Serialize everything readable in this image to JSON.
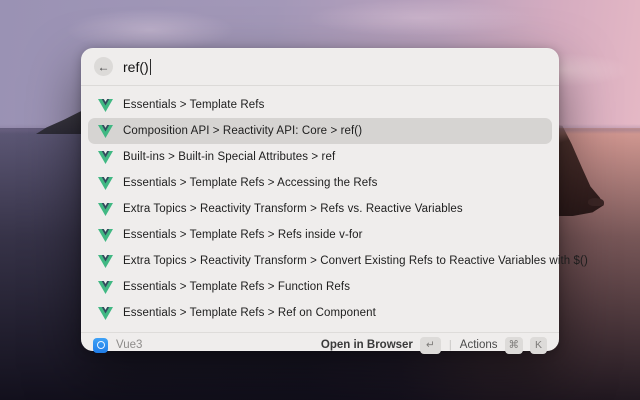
{
  "search": {
    "value": "ref()",
    "back_icon": "←"
  },
  "results": {
    "selected_index": 1,
    "items": [
      {
        "label": "Essentials > Template Refs"
      },
      {
        "label": "Composition API > Reactivity API: Core > ref()"
      },
      {
        "label": "Built-ins > Built-in Special Attributes > ref"
      },
      {
        "label": "Essentials > Template Refs > Accessing the Refs"
      },
      {
        "label": "Extra Topics > Reactivity Transform > Refs vs. Reactive Variables"
      },
      {
        "label": "Essentials > Template Refs > Refs inside v-for"
      },
      {
        "label": "Extra Topics > Reactivity Transform > Convert Existing Refs to Reactive Variables with $()"
      },
      {
        "label": "Essentials > Template Refs > Function Refs"
      },
      {
        "label": "Essentials > Template Refs > Ref on Component"
      }
    ]
  },
  "footer": {
    "app_name": "Vue3",
    "primary_action": "Open in Browser",
    "primary_key": "↵",
    "divider": "|",
    "secondary_action": "Actions",
    "secondary_keys": [
      "⌘",
      "K"
    ]
  },
  "colors": {
    "vue_green": "#41b883",
    "vue_dark": "#34495e",
    "extension_blue": "#2f8df5",
    "selection_gray": "#d6d4d2"
  }
}
